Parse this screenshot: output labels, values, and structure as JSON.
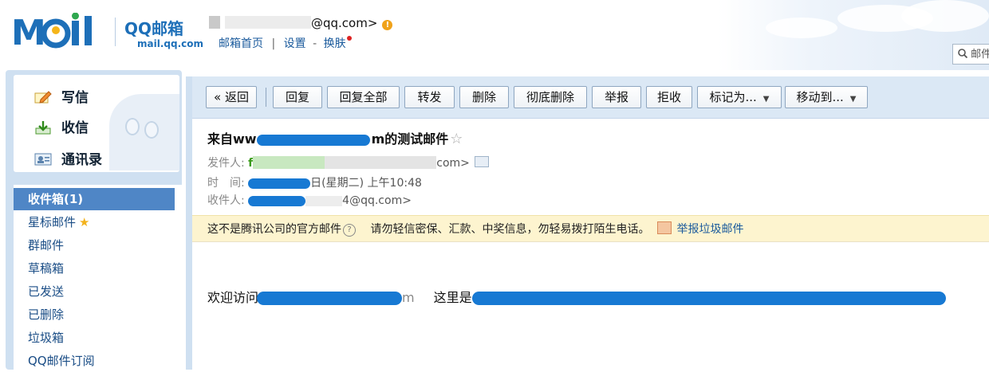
{
  "header": {
    "logo": {
      "word": "Mail",
      "product": "QQ邮箱",
      "domain": "mail.qq.com"
    },
    "account": {
      "email_suffix": "@qq.com>"
    },
    "links": {
      "home": "邮箱首页",
      "separator": "|",
      "settings": "设置",
      "dash": "-",
      "skin": "换肤"
    },
    "search": {
      "placeholder": "邮件"
    }
  },
  "sidebar": {
    "quick": [
      {
        "label": "写信",
        "icon": "compose-icon"
      },
      {
        "label": "收信",
        "icon": "inbox-download-icon"
      },
      {
        "label": "通讯录",
        "icon": "contacts-icon"
      }
    ],
    "folders": [
      {
        "label": "收件箱(1)",
        "active": true
      },
      {
        "label": "星标邮件",
        "star": "★"
      },
      {
        "label": "群邮件"
      },
      {
        "label": "草稿箱"
      },
      {
        "label": "已发送"
      },
      {
        "label": "已删除"
      },
      {
        "label": "垃圾箱"
      },
      {
        "label": "QQ邮件订阅"
      }
    ]
  },
  "toolbar": {
    "back": "« 返回",
    "reply": "回复",
    "reply_all": "回复全部",
    "forward": "转发",
    "delete": "删除",
    "delete_forever": "彻底删除",
    "report": "举报",
    "reject": "拒收",
    "mark_as": "标记为...",
    "move_to": "移动到...",
    "caret": "▼"
  },
  "message": {
    "subject_prefix": "来自ww",
    "subject_mid": "m",
    "subject_suffix": "的测试邮件",
    "star": "☆",
    "from_label": "发件人:",
    "from_start": "f",
    "from_end": "com>",
    "time_label": "时　间:",
    "time_value": "日(星期二) 上午10:48",
    "to_label": "收件人:",
    "to_value": "4@qq.com>"
  },
  "notice": {
    "official": "这不是腾讯公司的官方邮件",
    "help": "?",
    "warning": "请勿轻信密保、汇款、中奖信息，勿轻易拨打陌生电话。",
    "report_link": "举报垃圾邮件"
  },
  "body": {
    "welcome": "欢迎访问",
    "fragment_m": "m",
    "here_is": "这里是"
  }
}
